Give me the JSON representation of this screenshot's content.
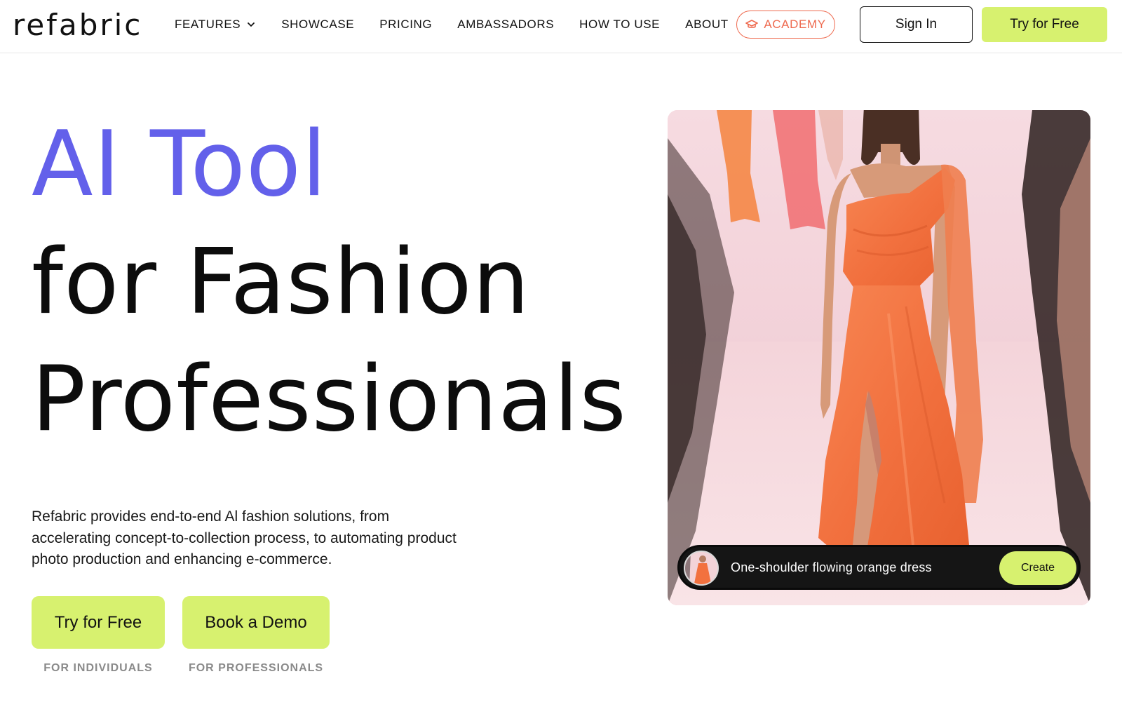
{
  "header": {
    "logo": "refabric",
    "nav": [
      {
        "label": "FEATURES",
        "icon": "chevron-down-icon"
      },
      {
        "label": "SHOWCASE"
      },
      {
        "label": "PRICING"
      },
      {
        "label": "AMBASSADORS"
      },
      {
        "label": "HOW TO USE"
      },
      {
        "label": "ABOUT"
      }
    ],
    "academy": {
      "label": "ACADEMY",
      "icon": "graduation-cap-icon"
    },
    "sign_in": "Sign In",
    "try_free": "Try for Free"
  },
  "hero": {
    "line1": "AI Tool",
    "line2": "for Fashion",
    "line3": "Professionals",
    "description": "Refabric provides end-to-end Al fashion solutions, from accelerating concept-to-collection process, to automating product photo production and enhancing e-commerce.",
    "cta_try": "Try for Free",
    "cta_try_sub": "FOR INDIVIDUALS",
    "cta_demo": "Book a Demo",
    "cta_demo_sub": "FOR PROFESSIONALS"
  },
  "showcase": {
    "prompt": "One-shoulder flowing orange dress",
    "create": "Create"
  },
  "colors": {
    "accent_purple": "#6360ea",
    "lime": "#d7f16f",
    "academy_orange": "#ee6a4f",
    "dress_orange": "#f2713f"
  }
}
